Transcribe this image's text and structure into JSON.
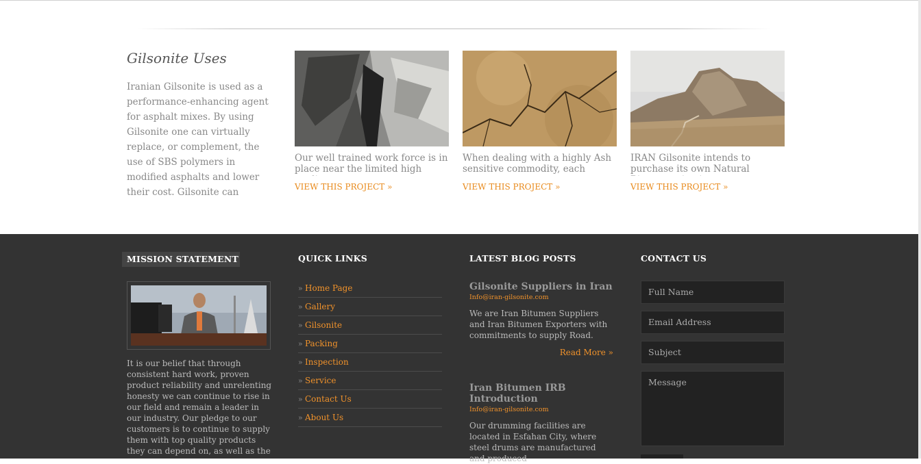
{
  "uses": {
    "title": "Gilsonite Uses",
    "text": "Iranian Gilsonite is used as a performance-enhancing agent for asphalt mixes. By using Gilsonite one can virtually replace, or complement, the use of SBS polymers in modified asphalts and lower their cost. Gilsonite can improve performance under stress"
  },
  "projects": [
    {
      "desc": "Our well trained work force is in place near the limited high quality",
      "link": "VIEW THIS PROJECT »",
      "image": "rock-quarry-image"
    },
    {
      "desc": "When dealing with a highly Ash sensitive commodity, each segment",
      "link": "VIEW THIS PROJECT »",
      "image": "cracked-earth-image"
    },
    {
      "desc": "IRAN Gilsonite intends to purchase its own Natural Bitumen mine in",
      "link": "VIEW THIS PROJECT »",
      "image": "desert-hill-image"
    }
  ],
  "footer": {
    "mission": {
      "heading": "MISSION STATEMENT",
      "text": "It is our belief that through consistent hard work, proven product reliability and unrelenting honesty we can continue to rise in our field and remain a leader in our industry. Our pledge to our customers is to continue to supply them with top quality products they can depend on, as well as the dedicated support and expertise they have come"
    },
    "quick_links": {
      "heading": "QUICK LINKS",
      "items": [
        "Home Page",
        "Gallery",
        "Gilsonite",
        "Packing",
        "Inspection",
        "Service",
        "Contact Us",
        "About Us"
      ]
    },
    "blog": {
      "heading": "LATEST BLOG POSTS",
      "posts": [
        {
          "title": "Gilsonite Suppliers in Iran",
          "meta": "Info@iran-gilsonite.com",
          "desc": "We are Iran Bitumen Suppliers and Iran Bitumen Exporters with commitments to supply Road.",
          "more": "Read More »"
        },
        {
          "title": "Iran Bitumen IRB Introduction",
          "meta": "Info@iran-gilsonite.com",
          "desc": "Our drumming facilities are located in Esfahan City, where steel drums are manufactured and produced",
          "more": ""
        }
      ]
    },
    "contact": {
      "heading": "CONTACT US",
      "full_name": "Full Name",
      "email": "Email Address",
      "subject": "Subject",
      "message": "Message"
    }
  },
  "colors": {
    "accent": "#f0922b",
    "footer_bg": "#333333"
  }
}
